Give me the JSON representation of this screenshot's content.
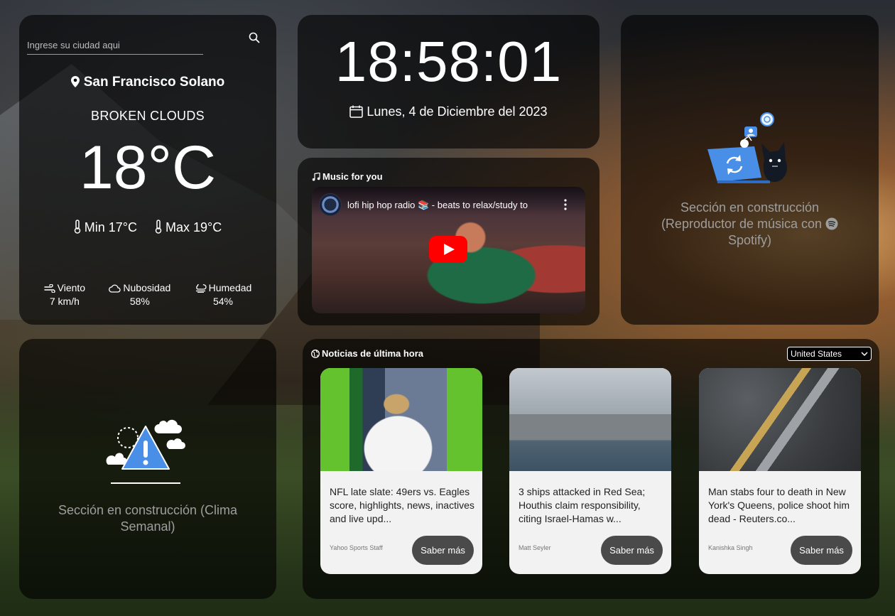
{
  "weather": {
    "search_placeholder": "Ingrese su ciudad aqui",
    "city": "San Francisco Solano",
    "condition": "BROKEN CLOUDS",
    "temperature": "18°C",
    "min": "Min 17°C",
    "max": "Max 19°C",
    "stats": [
      {
        "label": "Viento",
        "value": "7 km/h",
        "icon": "wind-icon"
      },
      {
        "label": "Nubosidad",
        "value": "58%",
        "icon": "cloud-icon"
      },
      {
        "label": "Humedad",
        "value": "54%",
        "icon": "humidity-icon"
      }
    ]
  },
  "clock": {
    "time": "18:58:01",
    "date": "Lunes, 4 de Diciembre del 2023"
  },
  "music": {
    "title": "Music for you",
    "video_title": "lofi hip hop radio 📚 - beats to relax/study to"
  },
  "spotify": {
    "text": "Sección en construcción (Reproductor de música con",
    "text_end": "Spotify)"
  },
  "weekly": {
    "text": "Sección en construcción (Clima Semanal)"
  },
  "news": {
    "title": "Noticias de última hora",
    "country": "United States",
    "button_label": "Saber más",
    "articles": [
      {
        "text": "NFL late slate: 49ers vs. Eagles score, highlights, news, inactives and live upd...",
        "author": "Yahoo Sports Staff"
      },
      {
        "text": "3 ships attacked in Red Sea; Houthis claim responsibility, citing Israel-Hamas w...",
        "author": "Matt Seyler"
      },
      {
        "text": "Man stabs four to death in New York's Queens, police shoot him dead - Reuters.co...",
        "author": "Kanishka Singh"
      }
    ]
  },
  "colors": {
    "card_bg": "#000000",
    "accent_blue": "#4a8fe7",
    "youtube_red": "#ff0000",
    "button_bg": "#4a4a4a"
  }
}
